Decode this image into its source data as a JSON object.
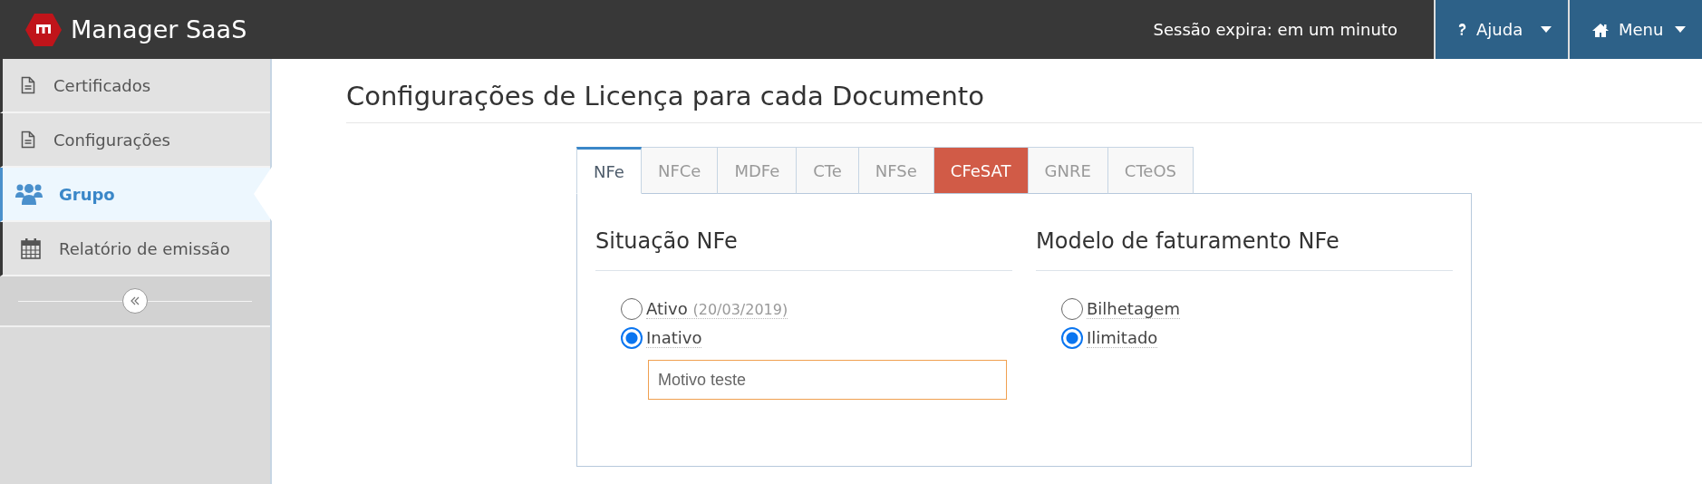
{
  "header": {
    "app_name": "Manager SaaS",
    "session": "Sessão expira: em um minuto",
    "buttons": [
      {
        "kind": "help",
        "label": "Ajuda"
      },
      {
        "kind": "home",
        "label": "Menu"
      }
    ]
  },
  "sidebar": {
    "items": [
      {
        "kind": "document",
        "label": "Certificados",
        "selected": false
      },
      {
        "kind": "document",
        "label": "Configurações",
        "selected": false
      },
      {
        "kind": "group",
        "label": "Grupo",
        "selected": true
      },
      {
        "kind": "calendar",
        "label": "Relatório de emissão",
        "selected": false
      }
    ]
  },
  "page_title": "Configurações de Licença para cada Documento",
  "tabs": [
    {
      "label": "NFe",
      "selected": true,
      "highlighted": false
    },
    {
      "label": "NFCe",
      "selected": false,
      "highlighted": false
    },
    {
      "label": "MDFe",
      "selected": false,
      "highlighted": false
    },
    {
      "label": "CTe",
      "selected": false,
      "highlighted": false
    },
    {
      "label": "NFSe",
      "selected": false,
      "highlighted": false
    },
    {
      "label": "CFeSAT",
      "selected": false,
      "highlighted": true
    },
    {
      "label": "GNRE",
      "selected": false,
      "highlighted": false
    },
    {
      "label": "CTeOS",
      "selected": false,
      "highlighted": false
    }
  ],
  "sections": [
    {
      "title": "Situação NFe",
      "options": [
        {
          "label": "Ativo",
          "note": "(20/03/2019)",
          "selected": false
        },
        {
          "label": "Inativo",
          "selected": true
        }
      ],
      "reason": {
        "value": "Motivo teste",
        "focused": true
      }
    },
    {
      "title": "Modelo de faturamento NFe",
      "options": [
        {
          "label": "Bilhetagem",
          "selected": false
        },
        {
          "label": "Ilimitado",
          "selected": true
        }
      ]
    }
  ]
}
